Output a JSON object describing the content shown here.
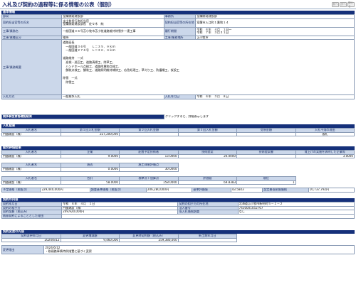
{
  "page_title": "入札及び契約の過程等に係る情報の公表（個別）",
  "nav": {
    "prev": "前へ",
    "next": "次へ",
    "close": "閉じる"
  },
  "basic": {
    "title": "基本情報",
    "dept_label": "部局",
    "dept": "室蘭開発建設部",
    "office_label": "事務所",
    "office": "室蘭開発建設部",
    "contract_officer_label": "契約担当官等の氏名",
    "contract_officer": "支出負担行為担当官\n室蘭開発建設部長　佐々木　純",
    "contract_officer_addr_label": "契約担当官等の所在地",
    "contract_officer_addr": "室蘭市入江町１番地１４",
    "work_name_label": "工事/業務名",
    "work_name": "一般国道３６号苫小牧市苫小牧道路維持除雪外一連工事",
    "period_label": "履行期間",
    "period": "令和　６年　４月　１日～\n令和　７年　３月３１日",
    "work_type_label": "工事/業種区分",
    "work_type": "維持",
    "location_label": "工事/業務場所",
    "location": "苫小牧市",
    "summary_label": "工事/業務概要",
    "summary": "道路延長\n　一般国道３６号　　Ｌ＝３５．９ｋｍ\n　一般国道２７６号　Ｌ＝２０．０ｋｍ\n\n道路維持　一式\n　巡視・巡回工、道路清掃工、除草工、\n　ハンドホール点検工、道路附属物点検工、\n　舗装点検工、舗装工、道路照明維持補修工、応急処理工、草刈り工、防護柵工、仮設工\n\n除雪　一式\n　除雪工",
    "bid_method_label": "入札方式",
    "bid_method": "一般競争入札",
    "bid_date_label": "入札年月日",
    "bid_date": "令和　６年　３月　８日"
  },
  "competition": {
    "title": "競争参加資格確認結果",
    "note": "クリックすると、詳細表示します"
  },
  "bid_result": {
    "title": "入札結果",
    "headers": [
      "入札者名",
      "第１回入札金額",
      "第２回入札金額",
      "第３回入札金額",
      "受領金額",
      "入札不落の理由"
    ],
    "rows": [
      [
        "門脇建設（株）",
        "227,200,000",
        "",
        "",
        "",
        "落札"
      ]
    ]
  },
  "eval": {
    "title": "総合評価結果",
    "h1": [
      "入札者名",
      "企業",
      "配置予定技術者",
      "技術提案",
      "技術提案書",
      "賃上げの実施を表明した企業等"
    ],
    "r1": [
      "門脇建設（株）",
      "9.0000",
      "13.0000",
      "20.0000",
      "",
      "3.0000"
    ],
    "h2": [
      "入札者名",
      "過去",
      "施工体制評価点"
    ],
    "r2": [
      "門脇建設（株）",
      "0.0000",
      "30.0000"
    ],
    "h3": [
      "入札者名",
      "合計",
      "標準点＋加算点",
      "評価値",
      "順位"
    ],
    "r3": [
      "門脇建設（株）",
      "58.0000",
      "158.0000",
      "69.8383",
      "1"
    ]
  },
  "summary_row": {
    "budget_label": "予定価格（税抜き）",
    "budget": "229,440,000円",
    "survey_label": "調査基準価格（税抜き）",
    "survey": "206,280,000円",
    "min_eval_label": "基準評価値",
    "min_eval": "43.5843",
    "min_price_label": "設定最低制限価格",
    "min_price": "10,737,792円"
  },
  "contract": {
    "title": "契約の内容",
    "date_label": "契約年月日",
    "date": "令和　６年　４月　１日",
    "partner_addr_label": "契約の相手方の所在地",
    "partner_addr": "北海道苫小牧市新明町５－１－２",
    "partner_label": "契約の相手方",
    "partner": "門脇建設（株）",
    "corp_no_label": "法人番号",
    "corp_no": "7430001052767",
    "amount_label": "契約金額（税込み）",
    "amount": "249,920,000円",
    "low_bid_label": "低入札価格調査",
    "low_bid": "なし",
    "reason_label": "随意契約によることとした理由",
    "reason": ""
  },
  "changes": {
    "title": "契約変更の内容",
    "headers": [
      "契約変更年月日",
      "変更増減額",
      "変更時契約額（税込み）",
      "新工期年月日"
    ],
    "rows": [
      [
        "2024/6/12",
        "9,460,000",
        "259,380,000",
        ""
      ]
    ],
    "reason_label": "変更理由",
    "reason": "2024/6/12\n・軟弱路事情特例措置に基づく変更"
  }
}
